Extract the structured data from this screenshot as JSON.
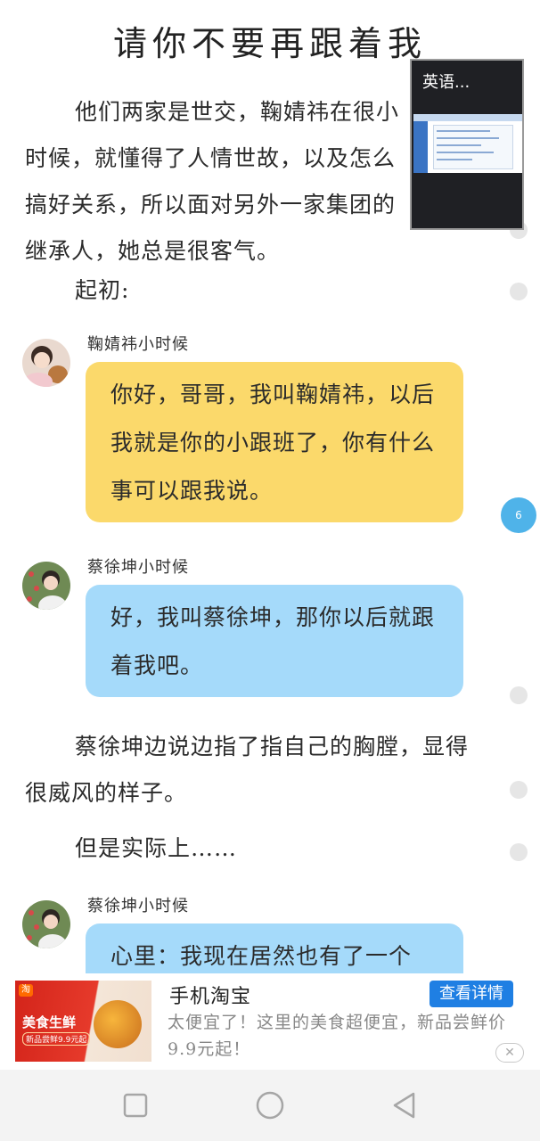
{
  "title": "请你不要再跟着我",
  "paragraphs": {
    "p1": "他们两家是世交，鞠婧祎在很小时候，就懂得了人情世故，以及怎么搞好关系，所以面对另外一家集团的继承人，她总是很客气。",
    "p2": "起初:",
    "p3": "蔡徐坤边说边指了指自己的胸膛，显得很威风的样子。",
    "p4": "但是实际上……"
  },
  "dialogues": [
    {
      "speaker": "鞠婧祎小时候",
      "text": "你好，哥哥，我叫鞠婧祎，以后我就是你的小跟班了，你有什么事可以跟我说。",
      "color": "#fbd96b"
    },
    {
      "speaker": "蔡徐坤小时候",
      "text": "好，我叫蔡徐坤，那你以后就跟着我吧。",
      "color": "#a5dafa"
    },
    {
      "speaker": "蔡徐坤小时候",
      "text": "心里：我现在居然也有了一个",
      "color": "#a5dafa"
    }
  ],
  "comment_count": "6",
  "float_window": {
    "title": "英语..."
  },
  "ad": {
    "image_badge": "淘",
    "image_headline": "美食生鲜",
    "image_tag": "新品尝鲜9.9元起",
    "title": "手机淘宝",
    "description": "太便宜了！这里的美食超便宜，新品尝鲜价9.9元起！",
    "button_label": "查看详情",
    "close_symbol": "✕"
  },
  "navbar": {
    "icons": [
      "recent-apps-icon",
      "home-icon",
      "back-icon"
    ]
  },
  "colors": {
    "badge": "#4fb3e9",
    "ad_button": "#1f7fe3",
    "yellow_bubble": "#fbd96b",
    "blue_bubble": "#a5dafa"
  }
}
